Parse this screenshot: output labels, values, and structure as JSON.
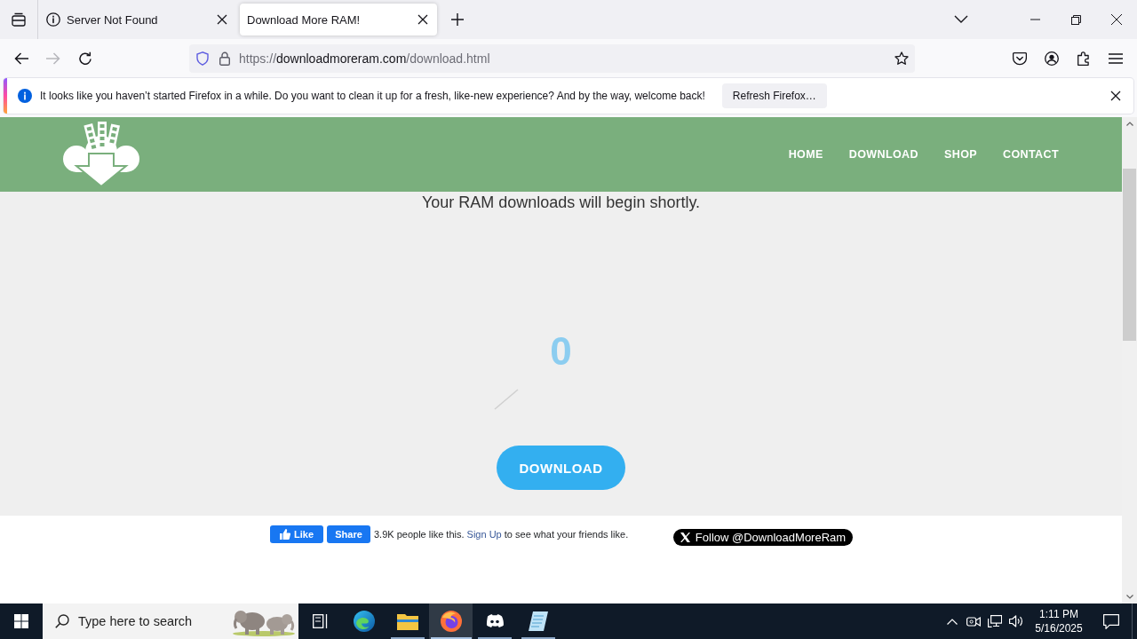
{
  "browser": {
    "tabs": [
      {
        "kind": "info",
        "title": "Server Not Found",
        "selected": false
      },
      {
        "kind": "plain",
        "title": "Download More RAM!",
        "selected": true
      }
    ],
    "back_button": {
      "disabled": false
    },
    "forward_button": {
      "disabled": true
    },
    "address": {
      "scheme": "https://",
      "domain": "downloadmoreram.com",
      "path": "/download.html"
    },
    "notification": {
      "message": "It looks like you haven’t started Firefox in a while. Do you want to clean it up for a fresh, like-new experience? And by the way, welcome back!",
      "button": "Refresh Firefox…"
    }
  },
  "site": {
    "nav": [
      "HOME",
      "DOWNLOAD",
      "SHOP",
      "CONTACT"
    ],
    "notice": "Your RAM downloads will begin shortly.",
    "counter": "0",
    "download_button": "DOWNLOAD",
    "social": {
      "like_button": "Like",
      "share_button": "Share",
      "like_count": "3.9K people like this.",
      "signup_link": "Sign Up",
      "signup_rest": "to see what your friends like.",
      "follow_button": "Follow @DownloadMoreRam"
    }
  },
  "taskbar": {
    "search_placeholder": "Type here to search",
    "apps": [
      {
        "kind": "edge",
        "running": false,
        "selected": false
      },
      {
        "kind": "explorer",
        "running": true,
        "selected": false
      },
      {
        "kind": "firefox",
        "running": true,
        "selected": true
      },
      {
        "kind": "discord",
        "running": true,
        "selected": false
      },
      {
        "kind": "notes",
        "running": true,
        "selected": false
      }
    ],
    "time": "1:11 PM",
    "date": "5/16/2025"
  }
}
